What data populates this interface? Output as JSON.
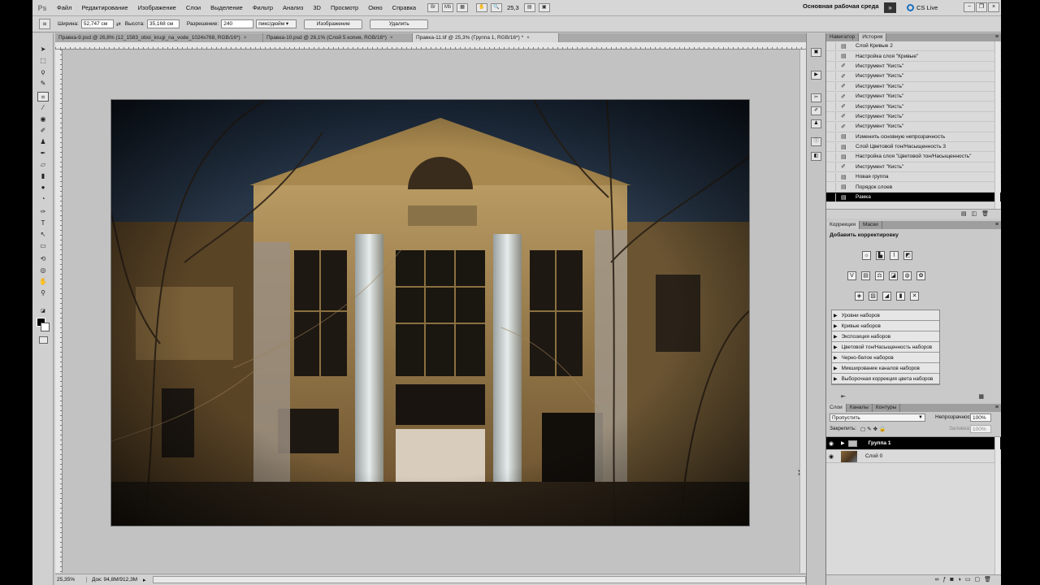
{
  "menubar": {
    "logo": "Ps",
    "items": [
      "Файл",
      "Редактирование",
      "Изображение",
      "Слои",
      "Выделение",
      "Фильтр",
      "Анализ",
      "3D",
      "Просмотр",
      "Окно",
      "Справка"
    ],
    "zoom": "25,3",
    "workspace": "Основная рабочая среда",
    "workspace_more": "»",
    "cslive": "CS Live"
  },
  "options": {
    "width_label": "Ширина:",
    "width_value": "52,747 см",
    "height_label": "Высота:",
    "height_value": "35,168 см",
    "resolution_label": "Разрешение:",
    "resolution_value": "240",
    "resolution_unit": "пикс/дюйм",
    "image_button": "Изображение",
    "delete_button": "Удалить"
  },
  "tabs": [
    {
      "label": "Правка-9.psd @ 26,8% (12_1583_oboi_krugi_na_vode_1024x768, RGB/16*)",
      "close": "×",
      "active": false
    },
    {
      "label": "Правка-10.psd @ 26,1% (Слой 5 копия, RGB/16*)",
      "close": "×",
      "active": false
    },
    {
      "label": "Правка-11.tif @ 25,3% (Группа 1, RGB/16*) *",
      "close": "×",
      "active": true
    }
  ],
  "status": {
    "zoom": "25,35%",
    "doc": "Док: 94,8M/912,3M",
    "arrow": "▸"
  },
  "history_panel": {
    "tabs": [
      "Навигатор",
      "История"
    ],
    "items": [
      {
        "icon": "doc",
        "label": "Слой Кривые 2",
        "current": false
      },
      {
        "icon": "doc",
        "label": "Настройка слоя \"Кривые\"",
        "current": false
      },
      {
        "icon": "brush",
        "label": "Инструмент \"Кисть\"",
        "current": false
      },
      {
        "icon": "brush",
        "label": "Инструмент \"Кисть\"",
        "current": false
      },
      {
        "icon": "brush",
        "label": "Инструмент \"Кисть\"",
        "current": false
      },
      {
        "icon": "brush",
        "label": "Инструмент \"Кисть\"",
        "current": false
      },
      {
        "icon": "brush",
        "label": "Инструмент \"Кисть\"",
        "current": false
      },
      {
        "icon": "brush",
        "label": "Инструмент \"Кисть\"",
        "current": false
      },
      {
        "icon": "brush",
        "label": "Инструмент \"Кисть\"",
        "current": false
      },
      {
        "icon": "doc",
        "label": "Изменить основную непрозрачность",
        "current": false
      },
      {
        "icon": "doc",
        "label": "Слой Цветовой тон/Насыщенность 3",
        "current": false
      },
      {
        "icon": "doc",
        "label": "Настройка слоя \"Цветовой тон/Насыщенность\"",
        "current": false
      },
      {
        "icon": "brush",
        "label": "Инструмент \"Кисть\"",
        "current": false
      },
      {
        "icon": "doc",
        "label": "Новая группа",
        "current": false
      },
      {
        "icon": "doc",
        "label": "Порядок слоев",
        "current": false
      },
      {
        "icon": "doc",
        "label": "Рамка",
        "current": true
      }
    ]
  },
  "adjustments_panel": {
    "tabs": [
      "Коррекция",
      "Маски"
    ],
    "title": "Добавить корректировку",
    "presets": [
      "Уровни наборов",
      "Кривые наборов",
      "Экспозиция наборов",
      "Цветовой тон/Насыщенность наборов",
      "Черно-белое наборов",
      "Микширование каналов наборов",
      "Выборочная коррекция цвета наборов"
    ]
  },
  "layers_panel": {
    "tabs": [
      "Слои",
      "Каналы",
      "Контуры"
    ],
    "blend_mode": "Пропустить",
    "opacity_label": "Непрозрачность:",
    "opacity_value": "100%",
    "lock_label": "Закрепить:",
    "fill_label": "Заливка:",
    "fill_value": "100%",
    "layers": [
      {
        "name": "Группа 1",
        "type": "group",
        "selected": true
      },
      {
        "name": "Слой 0",
        "type": "image",
        "selected": false
      }
    ]
  },
  "colors": {
    "foreground": "#000000",
    "background": "#ffffff",
    "selection": "#000000"
  }
}
